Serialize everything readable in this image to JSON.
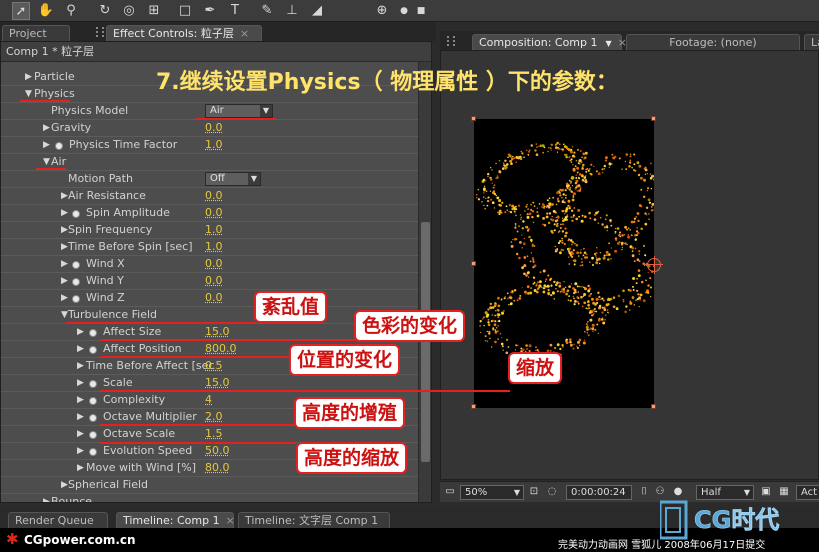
{
  "toolbar": {
    "tools": [
      "select-tool",
      "hand-tool",
      "zoom-tool",
      "rotate-tool",
      "camera-orbit-tool",
      "pan-behind-tool",
      "rectangle-mask-tool",
      "pen-tool",
      "text-tool",
      "brush-tool",
      "clone-stamp-tool",
      "eraser-tool",
      "axis-mode-tool"
    ]
  },
  "left_tabs": {
    "project": "Project",
    "effect_controls": "Effect Controls: 粒子层"
  },
  "effect_header": "Comp 1 * 粒子层",
  "rows": {
    "particle": "Particle",
    "physics": "Physics",
    "physics_model": "Physics Model",
    "physics_model_value": "Air",
    "gravity": "Gravity",
    "gravity_value": "0.0",
    "physics_time_factor": "Physics Time Factor",
    "physics_time_factor_value": "1.0",
    "air": "Air",
    "motion_path": "Motion Path",
    "motion_path_value": "Off",
    "air_resistance": "Air Resistance",
    "air_resistance_value": "0.0",
    "spin_amplitude": "Spin Amplitude",
    "spin_amplitude_value": "0.0",
    "spin_frequency": "Spin Frequency",
    "spin_frequency_value": "1.0",
    "time_before_spin": "Time Before Spin [sec]",
    "time_before_spin_value": "1.0",
    "wind_x": "Wind X",
    "wind_x_value": "0.0",
    "wind_y": "Wind Y",
    "wind_y_value": "0.0",
    "wind_z": "Wind Z",
    "wind_z_value": "0.0",
    "turbulence_field": "Turbulence Field",
    "affect_size": "Affect Size",
    "affect_size_value": "15.0",
    "affect_position": "Affect Position",
    "affect_position_value": "800.0",
    "time_before_affect": "Time Before Affect [sec",
    "time_before_affect_value": "0.5",
    "scale": "Scale",
    "scale_value": "15.0",
    "complexity": "Complexity",
    "complexity_value": "4",
    "octave_multiplier": "Octave Multiplier",
    "octave_multiplier_value": "2.0",
    "octave_scale": "Octave Scale",
    "octave_scale_value": "1.5",
    "evolution_speed": "Evolution Speed",
    "evolution_speed_value": "50.0",
    "move_with_wind": "Move with Wind [%]",
    "move_with_wind_value": "80.0",
    "spherical_field": "Spherical Field",
    "bounce": "Bounce"
  },
  "right_tabs": {
    "composition": "Composition: Comp 1",
    "footage": "Footage: (none)",
    "layer": "La"
  },
  "comp_footer": {
    "zoom": "50%",
    "timecode": "0:00:00:24",
    "resolution": "Half",
    "view": "Act"
  },
  "bottom_tabs": {
    "render_queue": "Render Queue",
    "timeline_comp1": "Timeline: Comp 1",
    "timeline_text": "Timeline: 文字层 Comp 1"
  },
  "annotations": {
    "title": "7.继续设置Physics（ 物理属性 ）下的参数：",
    "turbulence": "紊乱值",
    "color_change": "色彩的变化",
    "position_change": "位置的变化",
    "scale_note": "缩放",
    "height_increase": "高度的增殖",
    "height_scale": "高度的缩放"
  },
  "watermark": {
    "site": "CGpower.com.cn",
    "logo_text": "CG时代",
    "credit": "完美动力动画网 雪狐儿 2008年06月17日提交"
  },
  "colors": {
    "value_yellow": "#e8c640",
    "annotation_red": "#e52020",
    "title_yellow": "#ffe36a"
  }
}
